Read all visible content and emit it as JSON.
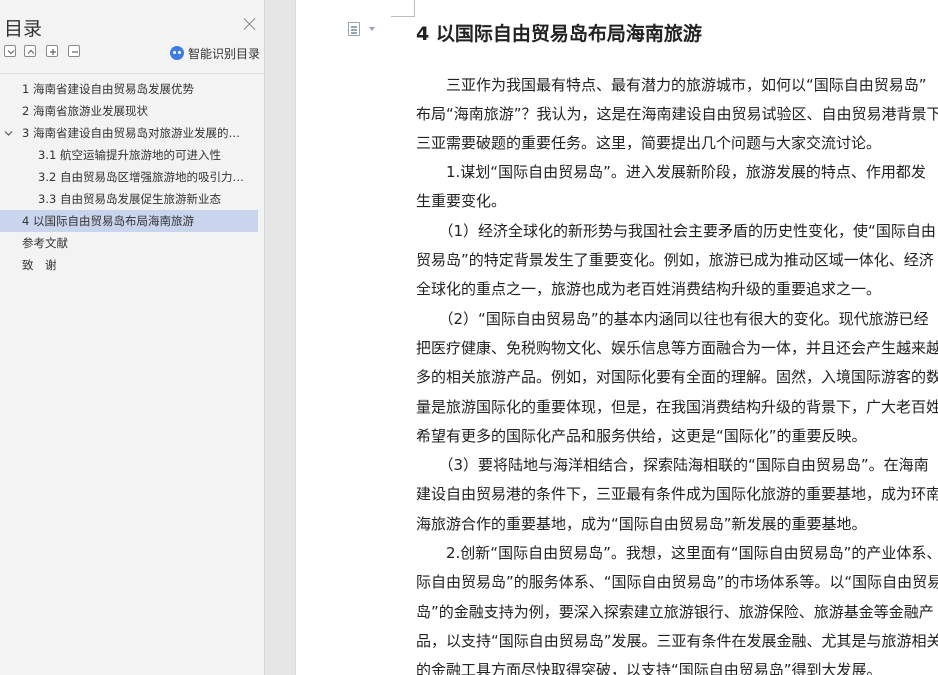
{
  "sidebar": {
    "title": "目录",
    "ai_label": "智能识别目录",
    "items": [
      {
        "label": "1 海南省建设自由贸易岛发展优势"
      },
      {
        "label": "2 海南省旅游业发展现状"
      },
      {
        "label": "3 海南省建设自由贸易岛对旅游业发展的影响"
      },
      {
        "label": "3.1 航空运输提升旅游地的可进入性"
      },
      {
        "label": "3.2 自由贸易岛区增强旅游地的吸引力与竞争力"
      },
      {
        "label": "3.3 自由贸易岛发展促生旅游新业态"
      },
      {
        "label": "4 以国际自由贸易岛布局海南旅游"
      },
      {
        "label": "参考文献"
      },
      {
        "label": "致　谢"
      }
    ]
  },
  "document": {
    "heading": "4 以国际自由贸易岛布局海南旅游",
    "lines": [
      "　　三亚作为我国最有特点、最有潜力的旅游城市，如何以“国际自由贸易岛”",
      "布局“海南旅游”？我认为，这是在海南建设自由贸易试验区、自由贸易港背景下",
      "三亚需要破题的重要任务。这里，简要提出几个问题与大家交流讨论。",
      "　　1.谋划“国际自由贸易岛”。进入发展新阶段，旅游发展的特点、作用都发",
      "生重要变化。",
      "　　（1）经济全球化的新形势与我国社会主要矛盾的历史性变化，使“国际自由",
      "贸易岛”的特定背景发生了重要变化。例如，旅游已成为推动区域一体化、经济",
      "全球化的重点之一，旅游也成为老百姓消费结构升级的重要追求之一。",
      "　　（2）“国际自由贸易岛”的基本内涵同以往也有很大的变化。现代旅游已经",
      "把医疗健康、免税购物文化、娱乐信息等方面融合为一体，并且还会产生越来越",
      "多的相关旅游产品。例如，对国际化要有全面的理解。固然，入境国际游客的数",
      "量是旅游国际化的重要体现，但是，在我国消费结构升级的背景下，广大老百姓",
      "希望有更多的国际化产品和服务供给，这更是“国际化”的重要反映。",
      "　　（3）要将陆地与海洋相结合，探索陆海相联的“国际自由贸易岛”。在海南",
      "建设自由贸易港的条件下，三亚最有条件成为国际化旅游的重要基地，成为环南",
      "海旅游合作的重要基地，成为“国际自由贸易岛”新发展的重要基地。",
      "　　2.创新“国际自由贸易岛”。我想，这里面有“国际自由贸易岛”的产业体系、“国",
      "际自由贸易岛”的服务体系、“国际自由贸易岛”的市场体系等。以“国际自由贸易",
      "岛”的金融支持为例，要深入探索建立旅游银行、旅游保险、旅游基金等金融产",
      "品，以支持“国际自由贸易岛”发展。三亚有条件在发展金融、尤其是与旅游相关",
      "的金融工具方面尽快取得突破，以支持“国际自由贸易岛”得到大发展。"
    ]
  }
}
